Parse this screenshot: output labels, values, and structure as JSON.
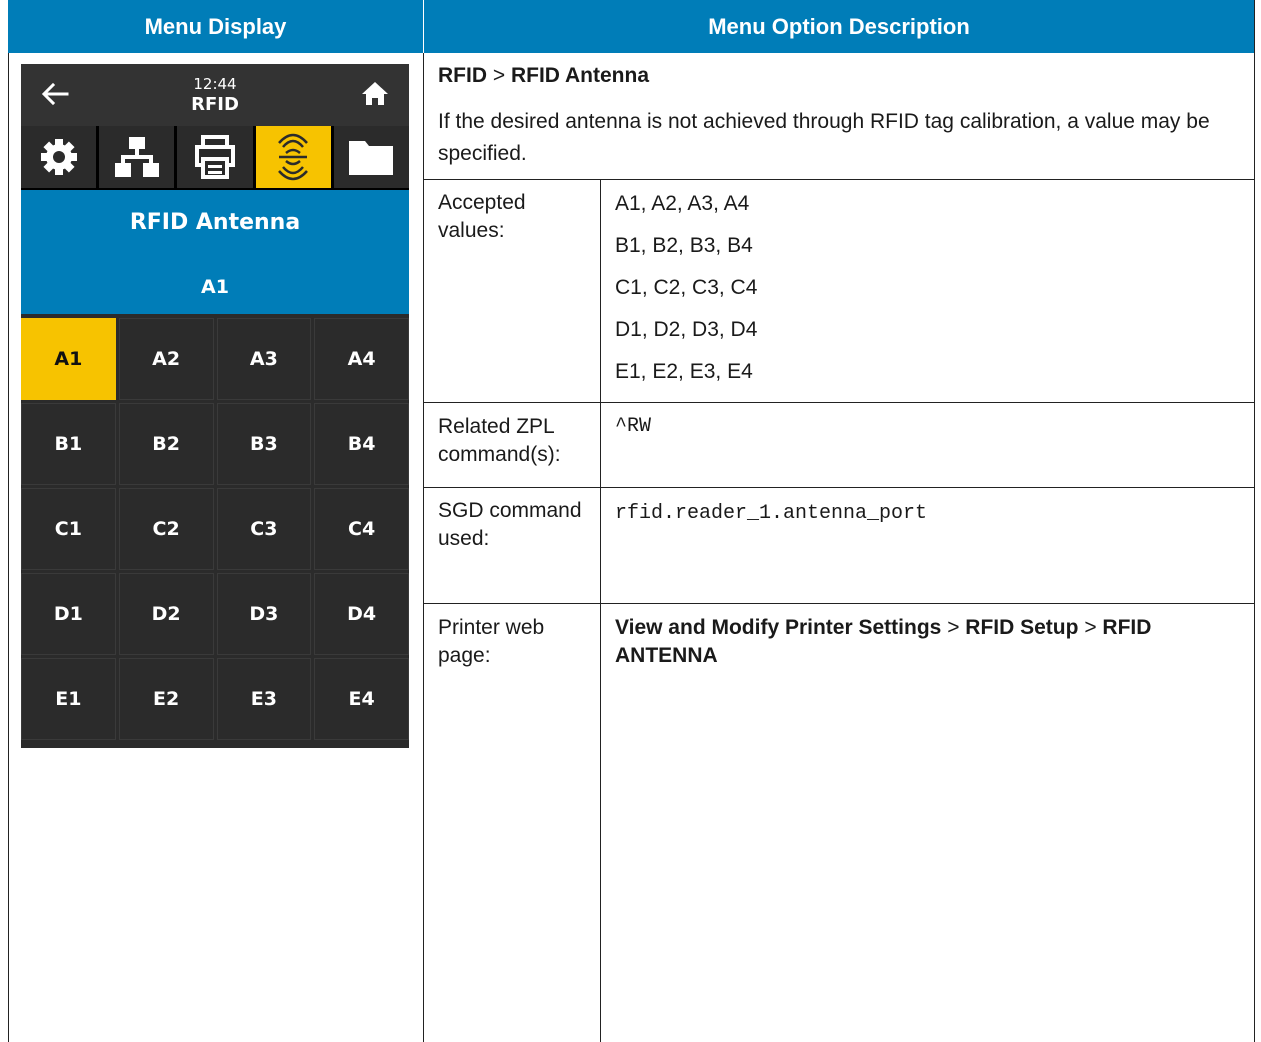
{
  "header": {
    "left": "Menu Display",
    "right": "Menu Option Description"
  },
  "device": {
    "time": "12:44",
    "title": "RFID",
    "tabs": [
      "settings-icon",
      "network-icon",
      "printer-icon",
      "rfid-icon",
      "folder-icon"
    ],
    "active_tab": "rfid-icon",
    "banner_title": "RFID Antenna",
    "banner_value": "A1",
    "grid": [
      [
        "A1",
        "A2",
        "A3",
        "A4"
      ],
      [
        "B1",
        "B2",
        "B3",
        "B4"
      ],
      [
        "C1",
        "C2",
        "C3",
        "C4"
      ],
      [
        "D1",
        "D2",
        "D3",
        "D4"
      ],
      [
        "E1",
        "E2",
        "E3",
        "E4"
      ]
    ],
    "selected": "A1",
    "colors": {
      "accent": "#f7c300",
      "banner": "#007db8",
      "panel": "#2b2b2b"
    }
  },
  "description": {
    "path_part1": "RFID",
    "path_sep": ">",
    "path_part2": "RFID Antenna",
    "text": "If the desired antenna is not achieved through RFID tag calibration, a value may be specified."
  },
  "rows": {
    "accepted_label": "Accepted values:",
    "accepted_values": [
      "A1, A2, A3, A4",
      "B1, B2, B3, B4",
      "C1, C2, C3, C4",
      "D1, D2, D3, D4",
      "E1, E2, E3, E4"
    ],
    "zpl_label": "Related ZPL command(s):",
    "zpl_value": "^RW",
    "sgd_label": "SGD command used:",
    "sgd_value": "rfid.reader_1.antenna_port",
    "web_label": "Printer web page:",
    "web_part1": "View and Modify Printer Settings",
    "web_sep1": ">",
    "web_part2": "RFID Setup",
    "web_sep2": ">",
    "web_part3": "RFID ANTENNA"
  }
}
